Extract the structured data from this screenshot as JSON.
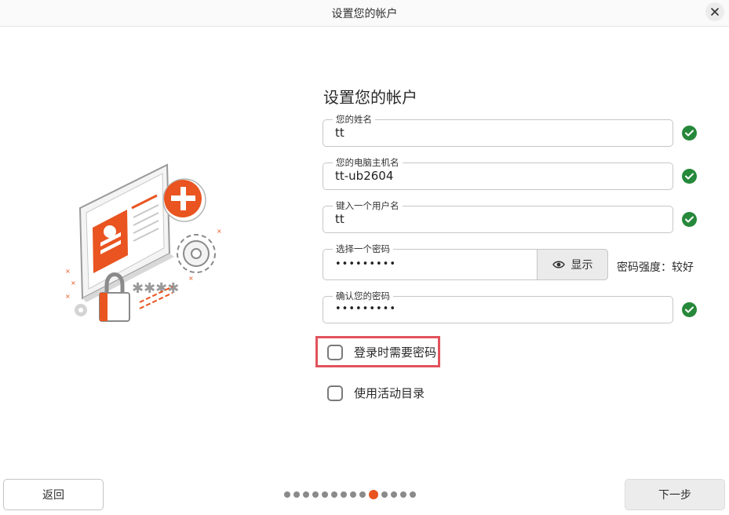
{
  "window": {
    "title": "设置您的帐户"
  },
  "page": {
    "title": "设置您的帐户"
  },
  "fields": {
    "name": {
      "label": "您的姓名",
      "value": "tt"
    },
    "hostname": {
      "label": "您的电脑主机名",
      "value": "tt-ub2604"
    },
    "username": {
      "label": "键入一个用户名",
      "value": "tt"
    },
    "password": {
      "label": "选择一个密码",
      "value": "•••••••••",
      "show_label": "显示",
      "strength": "密码强度：较好"
    },
    "confirm": {
      "label": "确认您的密码",
      "value": "•••••••••"
    }
  },
  "options": {
    "require_password": {
      "label": "登录时需要密码",
      "checked": false
    },
    "active_directory": {
      "label": "使用活动目录",
      "checked": false
    }
  },
  "navigation": {
    "back_label": "返回",
    "next_label": "下一步",
    "steps_total": 14,
    "current_step": 10
  },
  "colors": {
    "accent": "#E95420",
    "success": "#26883A",
    "highlight": "#E2535C"
  },
  "icons": [
    "close-icon",
    "check-icon",
    "eye-icon",
    "account-illustration"
  ]
}
